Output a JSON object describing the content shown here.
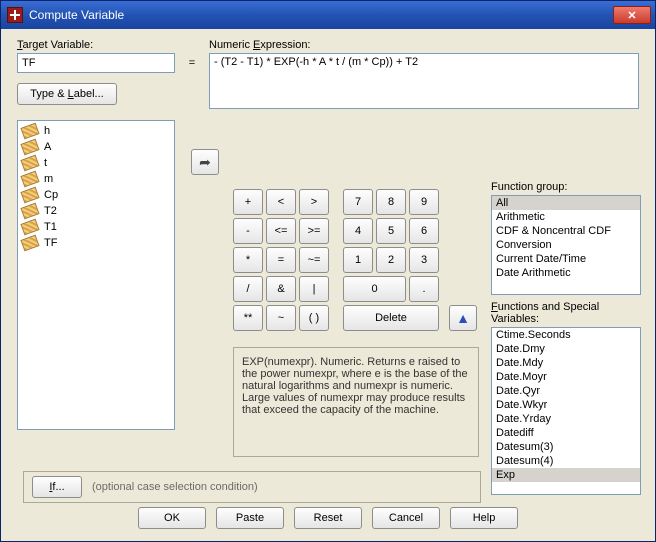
{
  "window": {
    "title": "Compute Variable"
  },
  "labels": {
    "target_variable": "Target Variable:",
    "type_label": "Type & Label...",
    "numeric_expression": "Numeric Expression:",
    "function_group": "Function group:",
    "functions_special": "Functions and Special Variables:",
    "equals": "="
  },
  "target": {
    "value": "TF"
  },
  "expression": {
    "value": "- (T2 - T1) * EXP(-h * A * t / (m * Cp)) + T2"
  },
  "variables": [
    "h",
    "A",
    "t",
    "m",
    "Cp",
    "T2",
    "T1",
    "TF"
  ],
  "keypad": {
    "r0": [
      "+",
      "<",
      ">",
      "7",
      "8",
      "9"
    ],
    "r1": [
      "-",
      "<=",
      ">=",
      "4",
      "5",
      "6"
    ],
    "r2": [
      "*",
      "=",
      "~=",
      "1",
      "2",
      "3"
    ],
    "r3": [
      "/",
      "&",
      "|",
      "0",
      "."
    ],
    "r4": [
      "**",
      "~",
      "( )",
      "Delete"
    ]
  },
  "function_groups": [
    "All",
    "Arithmetic",
    "CDF & Noncentral CDF",
    "Conversion",
    "Current Date/Time",
    "Date Arithmetic"
  ],
  "function_group_selected": 0,
  "functions": [
    "Ctime.Seconds",
    "Date.Dmy",
    "Date.Mdy",
    "Date.Moyr",
    "Date.Qyr",
    "Date.Wkyr",
    "Date.Yrday",
    "Datediff",
    "Datesum(3)",
    "Datesum(4)",
    "Exp"
  ],
  "function_selected": 10,
  "help_text": "EXP(numexpr). Numeric. Returns e raised to the power numexpr, where e is the base of the natural logarithms and numexpr is numeric. Large values of numexpr may produce results that exceed the capacity of the machine.",
  "if_row": {
    "button": "If...",
    "text": "(optional case selection condition)"
  },
  "buttons": {
    "ok": "OK",
    "paste": "Paste",
    "reset": "Reset",
    "cancel": "Cancel",
    "help": "Help"
  }
}
